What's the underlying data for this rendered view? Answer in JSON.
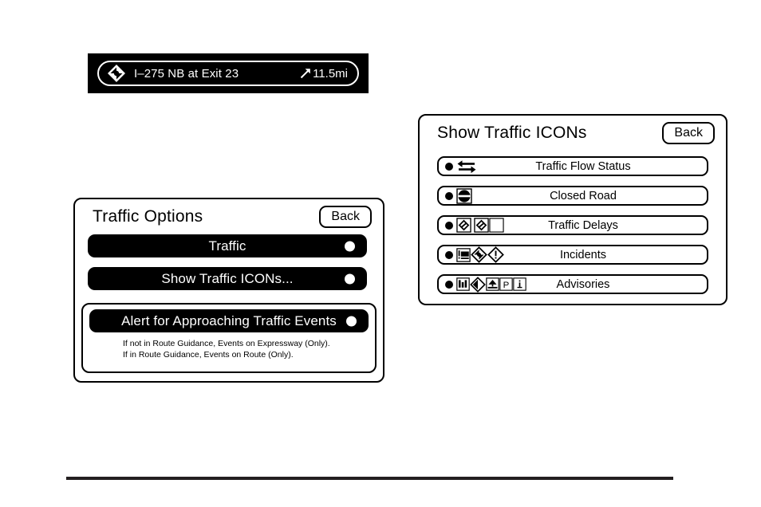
{
  "banner": {
    "icon": "traffic-diamond-icon",
    "road_label": "I–275 NB at Exit 23",
    "direction_icon": "arrow-northeast-icon",
    "distance": "11.5mi"
  },
  "traffic_options": {
    "title": "Traffic Options",
    "back_label": "Back",
    "rows": [
      {
        "label": "Traffic",
        "indicator": "radio-dot"
      },
      {
        "label": "Show Traffic ICONs...",
        "indicator": "radio-dot"
      },
      {
        "label": "Alert for Approaching Traffic Events",
        "indicator": "radio-dot"
      }
    ],
    "notes": [
      "If not in Route Guidance, Events on Expressway (Only).",
      "If in Route Guidance, Events on Route (Only)."
    ]
  },
  "show_traffic_icons": {
    "title": "Show Traffic ICONs",
    "back_label": "Back",
    "rows": [
      {
        "label": "Traffic Flow Status",
        "bullet": "filled-dot",
        "icons": [
          "two-way-arrows-icon"
        ]
      },
      {
        "label": "Closed Road",
        "bullet": "filled-dot",
        "icons": [
          "closed-road-icon"
        ]
      },
      {
        "label": "Traffic Delays",
        "bullet": "filled-dot",
        "icons": [
          "delay-diamond-boxed-icon",
          "delay-diamond-boxed-icon",
          "empty-box-icon"
        ]
      },
      {
        "label": "Incidents",
        "bullet": "filled-dot",
        "icons": [
          "incident-box-icon",
          "incident-diamond-icon",
          "exclamation-diamond-icon"
        ]
      },
      {
        "label": "Advisories",
        "bullet": "filled-dot",
        "icons": [
          "advisory-box-icon",
          "advisory-diamond-icon",
          "advisory-scene-box-icon",
          "parking-p-box-icon",
          "information-i-box-icon"
        ]
      }
    ]
  },
  "colors": {
    "foreground": "#000000",
    "background": "#ffffff",
    "bar_fill": "#000000",
    "bar_text": "#ffffff",
    "rule": "#231f20"
  }
}
